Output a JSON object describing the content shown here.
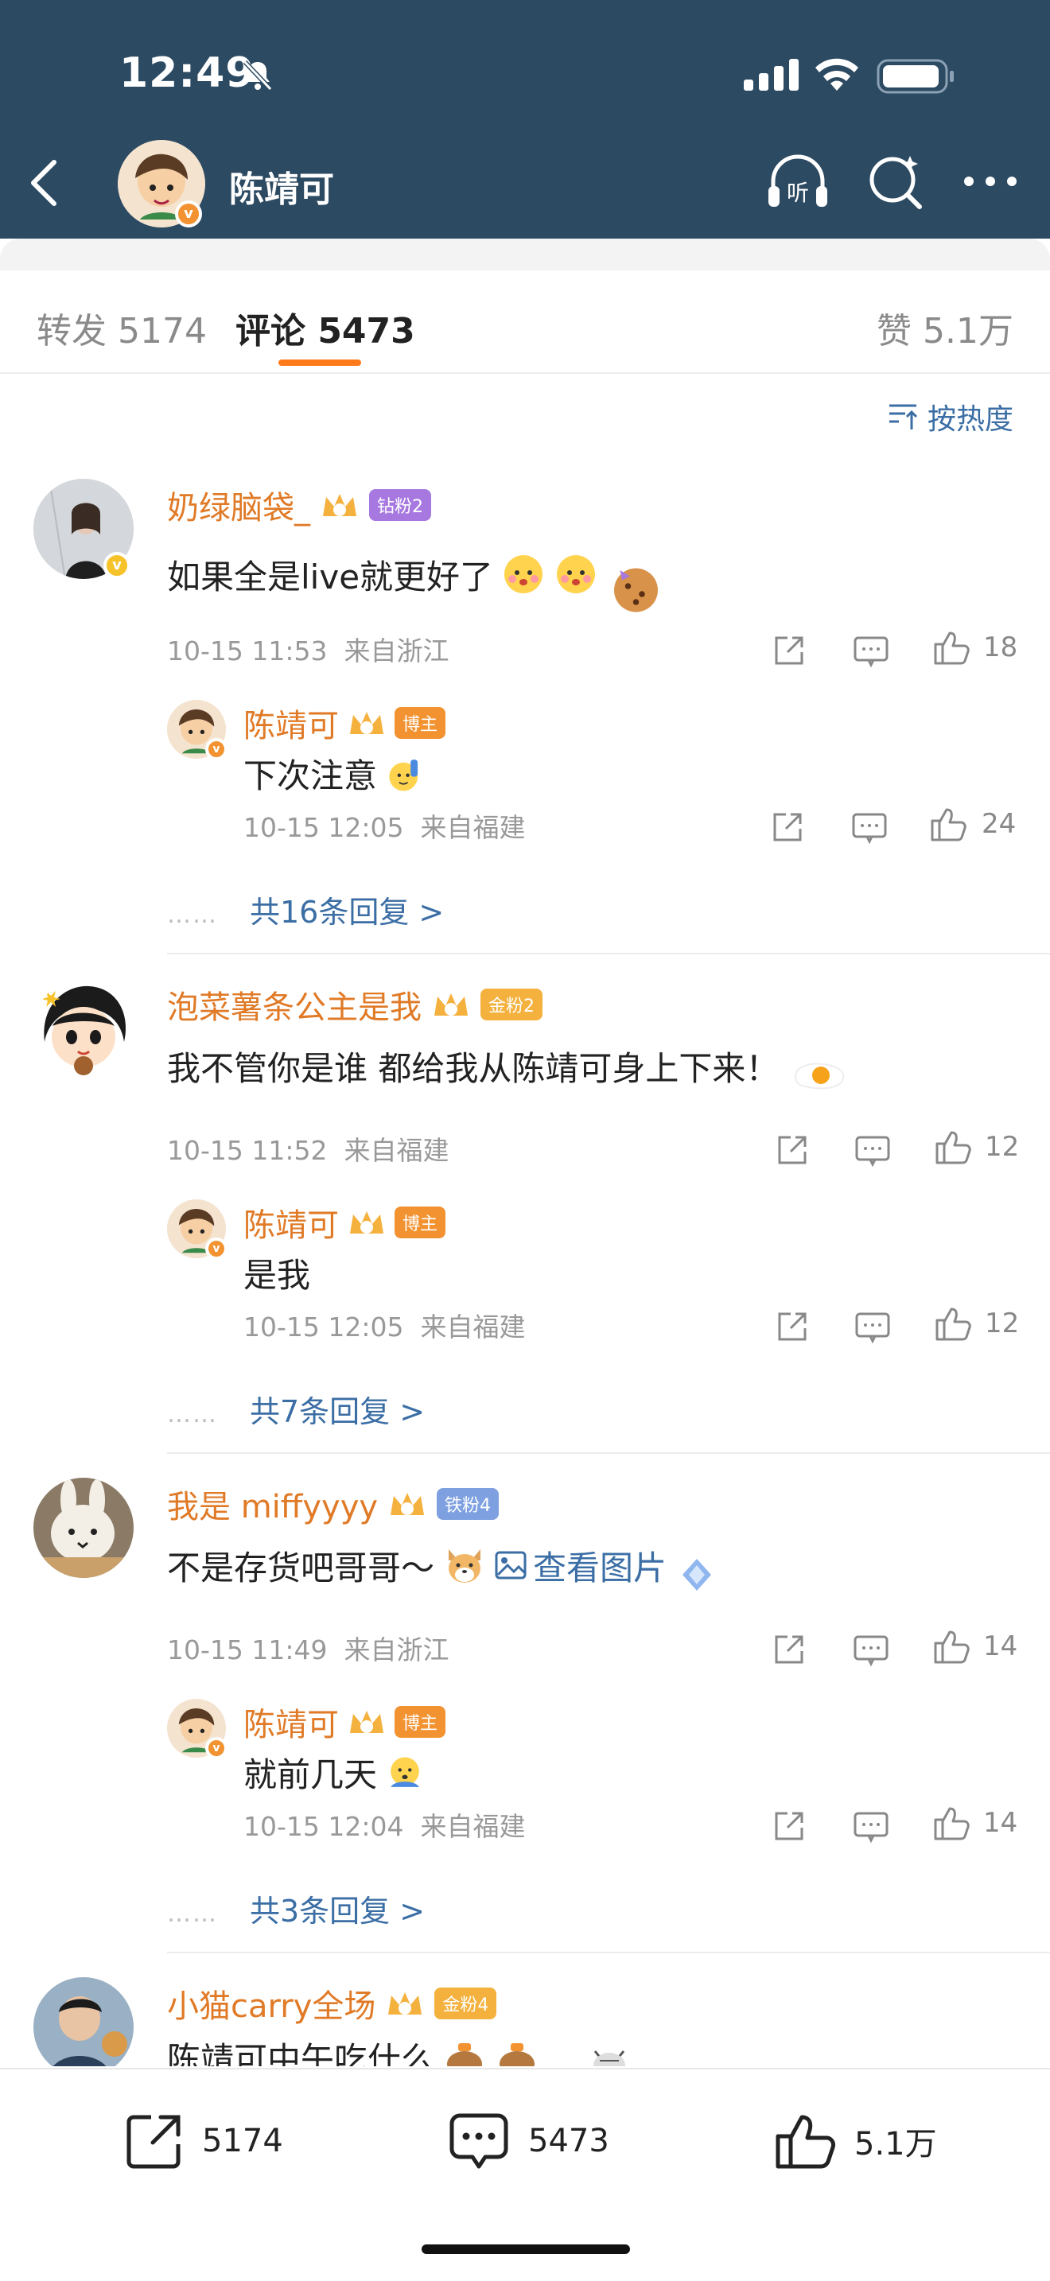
{
  "status_bar": {
    "time": "12:49"
  },
  "nav": {
    "title": "陈靖可",
    "verified": "v"
  },
  "tabs": [
    {
      "label": "转发 5174"
    },
    {
      "label": "评论 5473"
    },
    {
      "label": "赞 5.1万"
    }
  ],
  "sort": {
    "label": "按热度"
  },
  "comments": [
    {
      "name": "奶绿脑袋_",
      "badge": "钻粉2",
      "badge_color": "#a779e0",
      "text": "如果全是live就更好了",
      "time": "10-15 11:53",
      "location": "来自浙江",
      "likes": "18",
      "reply": {
        "name": "陈靖可",
        "badge": "博主",
        "text": "下次注意",
        "time": "10-15 12:05",
        "location": "来自福建",
        "likes": "24"
      },
      "more": "共16条回复 >"
    },
    {
      "name": "泡菜薯条公主是我",
      "badge": "金粉2",
      "badge_color": "#f4b13e",
      "text": "我不管你是谁 都给我从陈靖可身上下来！",
      "time": "10-15 11:52",
      "location": "来自福建",
      "likes": "12",
      "reply": {
        "name": "陈靖可",
        "badge": "博主",
        "text": "是我",
        "time": "10-15 12:05",
        "location": "来自福建",
        "likes": "12"
      },
      "more": "共7条回复 >"
    },
    {
      "name": "我是 miffyyyy",
      "badge": "铁粉4",
      "badge_color": "#7ea0e0",
      "text": "不是存货吧哥哥～",
      "link": "查看图片",
      "time": "10-15 11:49",
      "location": "来自浙江",
      "likes": "14",
      "reply": {
        "name": "陈靖可",
        "badge": "博主",
        "text": "就前几天",
        "time": "10-15 12:04",
        "location": "来自福建",
        "likes": "14"
      },
      "more": "共3条回复 >"
    },
    {
      "name": "小猫carry全场",
      "badge": "金粉4",
      "badge_color": "#f4b13e",
      "text": "陈靖可中午吃什么"
    }
  ],
  "bottom_bar": {
    "repost": "5174",
    "comment": "5473",
    "like": "5.1万"
  },
  "colors": {
    "header": "#2c4a62",
    "accent": "#ff7a1a",
    "name": "#e07a26",
    "link": "#3b6ea5"
  }
}
